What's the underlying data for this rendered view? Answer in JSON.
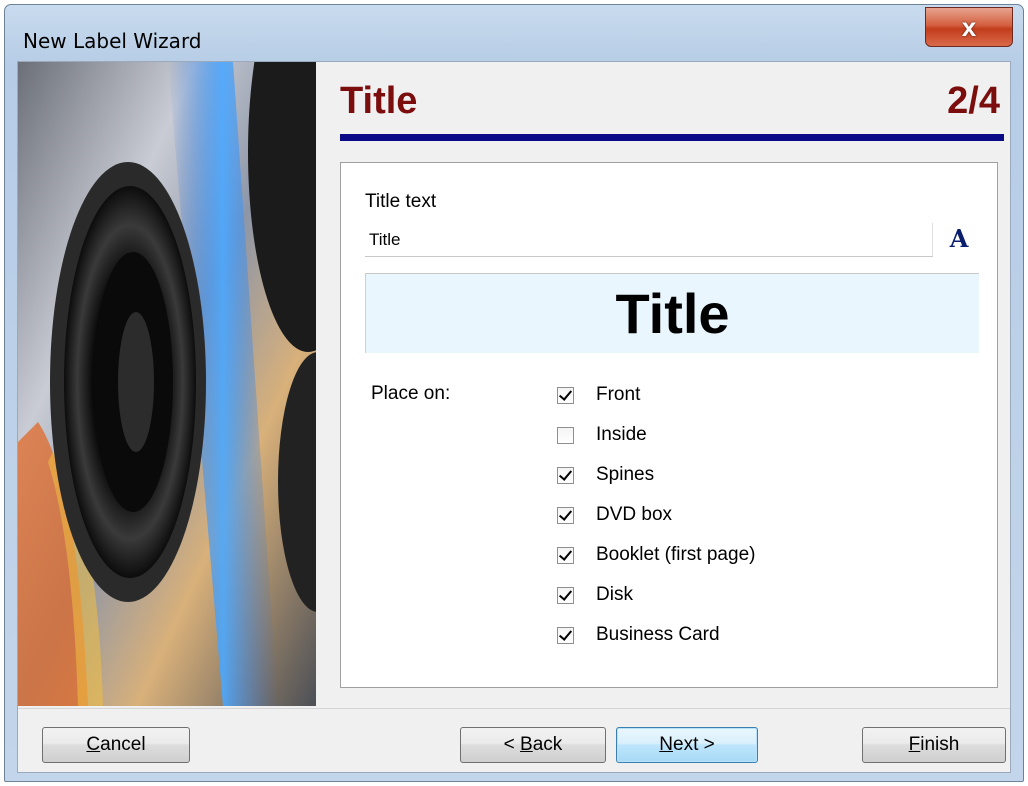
{
  "window": {
    "title": "New Label Wizard",
    "close_label": "x"
  },
  "header": {
    "title": "Title",
    "step": "2/4"
  },
  "form": {
    "title_text_label": "Title text",
    "title_text_value": "Title",
    "font_button_label": "A",
    "preview_text": "Title",
    "place_on_label": "Place on:",
    "places": [
      {
        "label": "Front",
        "checked": true
      },
      {
        "label": "Inside",
        "checked": false
      },
      {
        "label": "Spines",
        "checked": true
      },
      {
        "label": "DVD box",
        "checked": true
      },
      {
        "label": "Booklet (first page)",
        "checked": true
      },
      {
        "label": "Disk",
        "checked": true
      },
      {
        "label": "Business Card",
        "checked": true
      }
    ]
  },
  "buttons": {
    "cancel": {
      "pre": "",
      "key": "C",
      "post": "ancel"
    },
    "back": {
      "pre": "< ",
      "key": "B",
      "post": "ack"
    },
    "next": {
      "pre": "",
      "key": "N",
      "post": "ext >"
    },
    "finish": {
      "pre": "",
      "key": "F",
      "post": "inish"
    }
  }
}
